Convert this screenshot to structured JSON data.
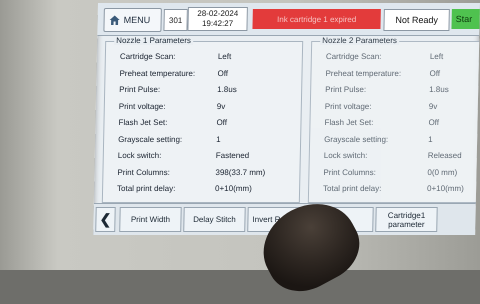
{
  "topbar": {
    "menu_label": "MENU",
    "channel": "301",
    "date": "28-02-2024",
    "time": "19:42:27",
    "alert_text": "Ink cartridge 1 expired",
    "status": "Not Ready",
    "start_label": "Star"
  },
  "nozzle1": {
    "title": "Nozzle 1 Parameters",
    "rows": [
      {
        "label": "Cartridge Scan:",
        "value": "Left"
      },
      {
        "label": "Preheat temperature:",
        "value": "Off"
      },
      {
        "label": "Print Pulse:",
        "value": "1.8us"
      },
      {
        "label": "Print voltage:",
        "value": "9v"
      },
      {
        "label": "Flash Jet Set:",
        "value": "Off"
      },
      {
        "label": "Grayscale setting:",
        "value": "1"
      },
      {
        "label": "Lock switch:",
        "value": "Fastened"
      },
      {
        "label": "Print Columns:",
        "value": "398(33.7 mm)"
      },
      {
        "label": "Total print delay:",
        "value": "0+10(mm)"
      }
    ]
  },
  "nozzle2": {
    "title": "Nozzle 2 Parameters",
    "rows": [
      {
        "label": "Cartridge Scan:",
        "value": "Left"
      },
      {
        "label": "Preheat temperature:",
        "value": "Off"
      },
      {
        "label": "Print Pulse:",
        "value": "1.8us"
      },
      {
        "label": "Print voltage:",
        "value": "9v"
      },
      {
        "label": "Flash Jet Set:",
        "value": "Off"
      },
      {
        "label": "Grayscale setting:",
        "value": "1"
      },
      {
        "label": "Lock switch:",
        "value": "Released"
      },
      {
        "label": "Print Columns:",
        "value": "0(0 mm)"
      },
      {
        "label": "Total print delay:",
        "value": "0+10(mm)"
      }
    ]
  },
  "toolbar": {
    "back_icon": "chevron-left-icon",
    "buttons": [
      {
        "label": "Print Width"
      },
      {
        "label": "Delay Stitch"
      },
      {
        "label": "Invert Reverse"
      },
      {
        "label": "e"
      },
      {
        "label": "Cartridge1 parameter"
      }
    ]
  },
  "colors": {
    "alert_bg": "#e33b3b",
    "start_bg": "#4fc24f",
    "screen_bg": "#e9eef2"
  }
}
